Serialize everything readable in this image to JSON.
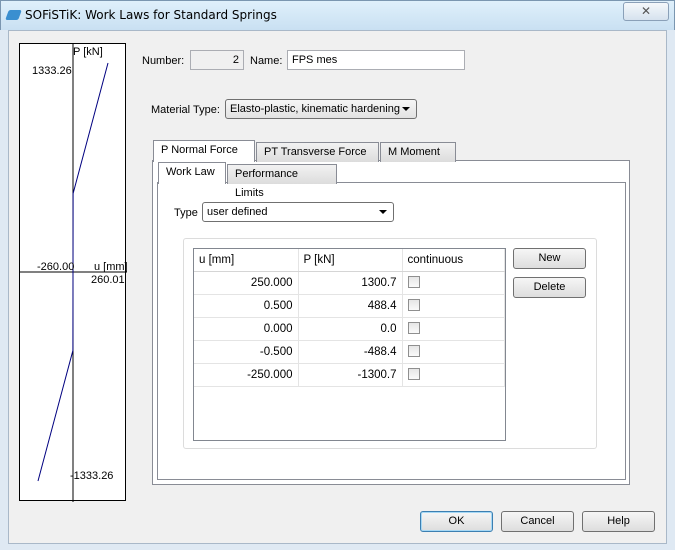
{
  "window": {
    "title": "SOFiSTiK: Work Laws for Standard Springs",
    "close_icon": "close-icon"
  },
  "form": {
    "number_label": "Number:",
    "number_value": "2",
    "name_label": "Name:",
    "name_value": "FPS mes",
    "material_type_label": "Material Type:",
    "material_type_value": "Elasto-plastic, kinematic hardening"
  },
  "tabs": [
    {
      "label": "P  Normal Force",
      "active": true
    },
    {
      "label": "PT  Transverse Force"
    },
    {
      "label": "M   Moment"
    }
  ],
  "subtabs": [
    {
      "label": "Work Law",
      "active": true
    },
    {
      "label": "Performance Limits"
    }
  ],
  "type": {
    "label": "Type",
    "value": "user defined"
  },
  "table": {
    "columns": [
      "u [mm]",
      "P  [kN]",
      "continuous"
    ],
    "rows": [
      {
        "u": "250.000",
        "p": "1300.7",
        "continuous": false
      },
      {
        "u": "0.500",
        "p": "488.4",
        "continuous": false
      },
      {
        "u": "0.000",
        "p": "0.0",
        "continuous": false
      },
      {
        "u": "-0.500",
        "p": "-488.4",
        "continuous": false
      },
      {
        "u": "-250.000",
        "p": "-1300.7",
        "continuous": false
      }
    ]
  },
  "buttons": {
    "new": "New",
    "delete": "Delete",
    "ok": "OK",
    "cancel": "Cancel",
    "help": "Help"
  },
  "chart_data": {
    "type": "line",
    "ylabel": "P [kN]",
    "xlabel": "u [mm]",
    "y_max_label": "1333.26",
    "y_min_label": "-1333.26",
    "x_min_label": "-260.00",
    "x_max_label": "260.01",
    "xlim": [
      -260,
      260.01
    ],
    "ylim": [
      -1333.26,
      1333.26
    ],
    "x": [
      250,
      0.5,
      0,
      -0.5,
      -250
    ],
    "y": [
      1300.7,
      488.4,
      0,
      -488.4,
      -1300.7
    ],
    "line_color": "#000080"
  }
}
